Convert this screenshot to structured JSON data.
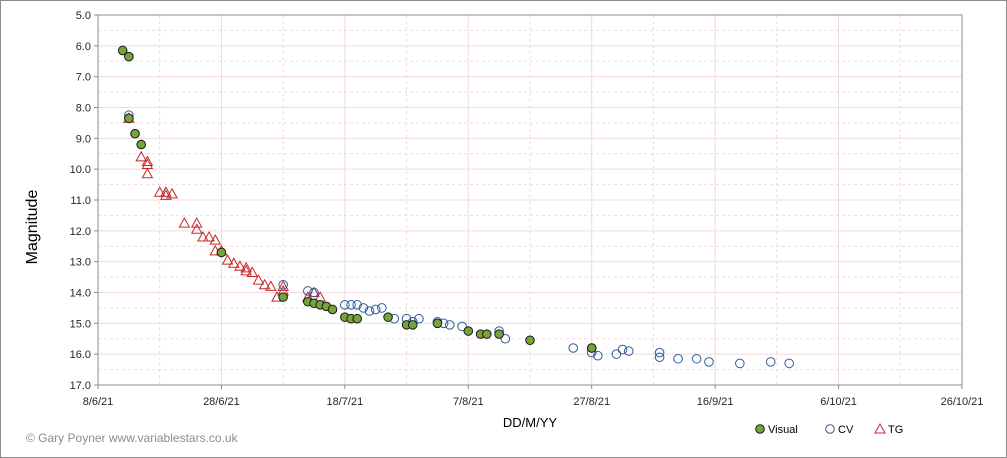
{
  "chart_data": {
    "type": "scatter",
    "xlabel": "DD/M/YY",
    "ylabel": "Magnitude",
    "x_ticks": [
      "8/6/21",
      "28/6/21",
      "18/7/21",
      "7/8/21",
      "27/8/21",
      "16/9/21",
      "6/10/21",
      "26/10/21"
    ],
    "y_ticks": [
      "5.0",
      "6.0",
      "7.0",
      "8.0",
      "9.0",
      "10.0",
      "11.0",
      "12.0",
      "13.0",
      "14.0",
      "15.0",
      "16.0",
      "17.0"
    ],
    "x_range_days_from_first_tick": [
      0,
      140
    ],
    "ylim": [
      5.0,
      17.0
    ],
    "y_inverted": true,
    "grid": true,
    "legend": "bottom-right",
    "credit": "© Gary Poyner www.variablestars.co.uk",
    "series": [
      {
        "name": "Visual",
        "marker": "filled-circle",
        "color": "#77a33b",
        "x": [
          "2021-06-12",
          "2021-06-13",
          "2021-06-13",
          "2021-06-14",
          "2021-06-15",
          "2021-06-28",
          "2021-07-08",
          "2021-07-12",
          "2021-07-13",
          "2021-07-14",
          "2021-07-15",
          "2021-07-16",
          "2021-07-18",
          "2021-07-19",
          "2021-07-20",
          "2021-07-25",
          "2021-07-28",
          "2021-07-29",
          "2021-08-02",
          "2021-08-07",
          "2021-08-09",
          "2021-08-10",
          "2021-08-12",
          "2021-08-17",
          "2021-08-27"
        ],
        "y": [
          6.15,
          6.35,
          8.35,
          8.85,
          9.2,
          12.7,
          14.15,
          14.3,
          14.35,
          14.4,
          14.45,
          14.55,
          14.8,
          14.85,
          14.85,
          14.8,
          15.05,
          15.05,
          15.0,
          15.25,
          15.35,
          15.35,
          15.35,
          15.55,
          15.8
        ]
      },
      {
        "name": "CV",
        "marker": "open-circle",
        "color": "#2e5c9a",
        "x": [
          "2021-06-13",
          "2021-07-08",
          "2021-07-12",
          "2021-07-13",
          "2021-07-18",
          "2021-07-19",
          "2021-07-20",
          "2021-07-21",
          "2021-07-22",
          "2021-07-23",
          "2021-07-24",
          "2021-07-26",
          "2021-07-28",
          "2021-07-29",
          "2021-07-30",
          "2021-08-02",
          "2021-08-03",
          "2021-08-04",
          "2021-08-06",
          "2021-08-12",
          "2021-08-13",
          "2021-08-24",
          "2021-08-27",
          "2021-08-27",
          "2021-08-28",
          "2021-08-31",
          "2021-09-01",
          "2021-09-02",
          "2021-09-07",
          "2021-09-07",
          "2021-09-10",
          "2021-09-13",
          "2021-09-15",
          "2021-09-20",
          "2021-09-25",
          "2021-09-28"
        ],
        "y": [
          8.25,
          13.75,
          13.95,
          14.0,
          14.4,
          14.4,
          14.4,
          14.5,
          14.6,
          14.55,
          14.5,
          14.85,
          14.85,
          14.95,
          14.85,
          14.95,
          15.0,
          15.05,
          15.1,
          15.25,
          15.5,
          15.8,
          15.95,
          15.8,
          16.05,
          16.0,
          15.85,
          15.9,
          15.95,
          16.1,
          16.15,
          16.15,
          16.25,
          16.3,
          16.25,
          16.3
        ]
      },
      {
        "name": "TG",
        "marker": "open-triangle",
        "color": "#c62828",
        "x": [
          "2021-06-13",
          "2021-06-15",
          "2021-06-16",
          "2021-06-16",
          "2021-06-16",
          "2021-06-18",
          "2021-06-19",
          "2021-06-19",
          "2021-06-20",
          "2021-06-22",
          "2021-06-24",
          "2021-06-24",
          "2021-06-25",
          "2021-06-26",
          "2021-06-27",
          "2021-06-27",
          "2021-06-28",
          "2021-06-29",
          "2021-06-30",
          "2021-07-01",
          "2021-07-02",
          "2021-07-02",
          "2021-07-03",
          "2021-07-04",
          "2021-07-05",
          "2021-07-06",
          "2021-07-07",
          "2021-07-08",
          "2021-07-08",
          "2021-07-12",
          "2021-07-13",
          "2021-07-14"
        ],
        "y": [
          8.35,
          9.6,
          9.75,
          9.85,
          10.15,
          10.75,
          10.75,
          10.85,
          10.8,
          11.75,
          11.75,
          11.95,
          12.2,
          12.2,
          12.3,
          12.65,
          12.65,
          12.95,
          13.05,
          13.15,
          13.2,
          13.3,
          13.35,
          13.6,
          13.75,
          13.8,
          14.15,
          13.95,
          13.8,
          14.15,
          14.0,
          14.15
        ]
      }
    ]
  }
}
